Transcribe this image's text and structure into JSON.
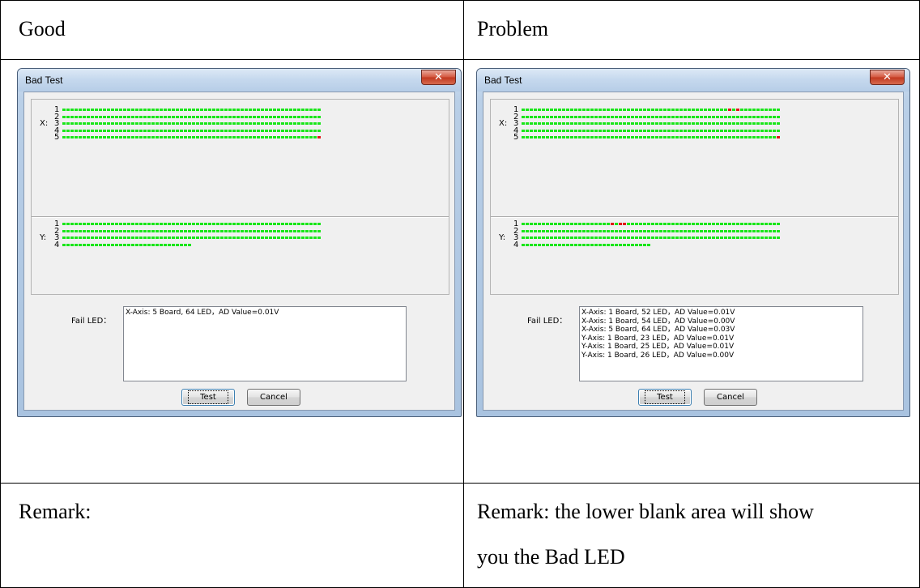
{
  "table": {
    "header_left": "Good",
    "header_right": "Problem",
    "remark_left": "Remark:",
    "remark_right_line1": "Remark: the lower blank area will show",
    "remark_right_line2": "you the Bad LED"
  },
  "dialogs": {
    "good": {
      "title": "Bad Test",
      "close_glyph": "✕",
      "x_label": "X:",
      "y_label": "Y:",
      "x_rows": [
        "1",
        "2",
        "3",
        "4",
        "5"
      ],
      "y_rows": [
        "1",
        "2",
        "3",
        "4"
      ],
      "x_leds_per_row": [
        64,
        64,
        64,
        64,
        64
      ],
      "y_leds_per_row": [
        64,
        64,
        64,
        32
      ],
      "x_bad": {
        "5": [
          64
        ]
      },
      "y_bad": {},
      "fail_label": "Fail LED：",
      "fail_lines": [
        "X-Axis: 5 Board, 64 LED，AD Value=0.01V"
      ],
      "test_button": "Test",
      "cancel_button": "Cancel"
    },
    "problem": {
      "title": "Bad Test",
      "close_glyph": "✕",
      "x_label": "X:",
      "y_label": "Y:",
      "x_rows": [
        "1",
        "2",
        "3",
        "4",
        "5"
      ],
      "y_rows": [
        "1",
        "2",
        "3",
        "4"
      ],
      "x_leds_per_row": [
        64,
        64,
        64,
        64,
        64
      ],
      "y_leds_per_row": [
        64,
        64,
        64,
        32
      ],
      "x_bad": {
        "1": [
          52,
          54
        ],
        "5": [
          64
        ]
      },
      "y_bad": {
        "1": [
          23,
          25,
          26
        ]
      },
      "fail_label": "Fail LED：",
      "fail_lines": [
        "X-Axis: 1 Board, 52 LED，AD Value=0.01V",
        "X-Axis: 1 Board, 54 LED，AD Value=0.00V",
        "X-Axis: 5 Board, 64 LED，AD Value=0.03V",
        "Y-Axis: 1 Board, 23 LED，AD Value=0.01V",
        "Y-Axis: 1 Board, 25 LED，AD Value=0.01V",
        "Y-Axis: 1 Board, 26 LED，AD Value=0.00V"
      ],
      "test_button": "Test",
      "cancel_button": "Cancel"
    }
  },
  "colors": {
    "led_ok": "#19e619",
    "led_bad": "#e01818",
    "dialog_bg": "#f0f0f0"
  }
}
